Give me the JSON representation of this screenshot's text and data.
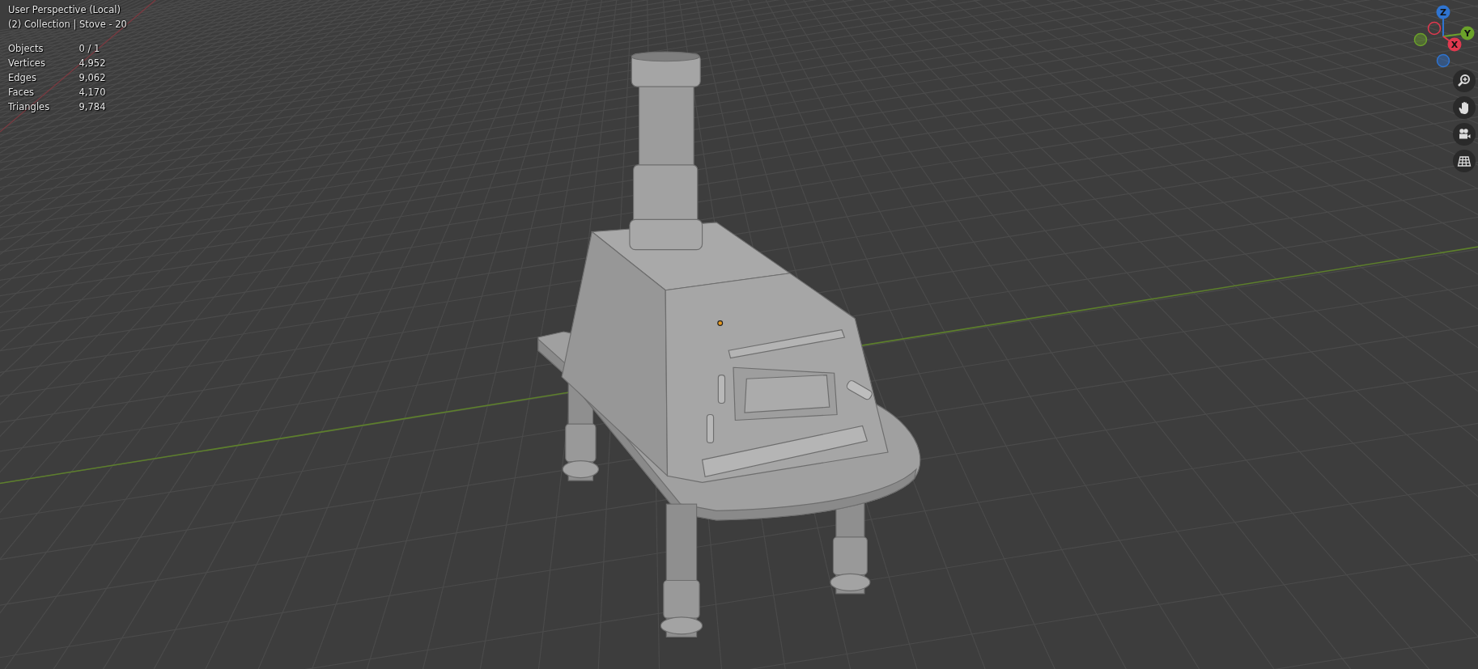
{
  "viewport": {
    "view_name": "User Perspective (Local)",
    "context": "(2) Collection | Stove - 20",
    "stats": [
      {
        "label": "Objects",
        "value": "0 / 1"
      },
      {
        "label": "Vertices",
        "value": "4,952"
      },
      {
        "label": "Edges",
        "value": "9,062"
      },
      {
        "label": "Faces",
        "value": "4,170"
      },
      {
        "label": "Triangles",
        "value": "9,784"
      }
    ]
  },
  "gizmo": {
    "axes": [
      {
        "label": "Z",
        "color": "#2f74d0"
      },
      {
        "label": "Y",
        "color": "#6ba22a"
      },
      {
        "label": "X",
        "color": "#e0394f"
      }
    ]
  }
}
